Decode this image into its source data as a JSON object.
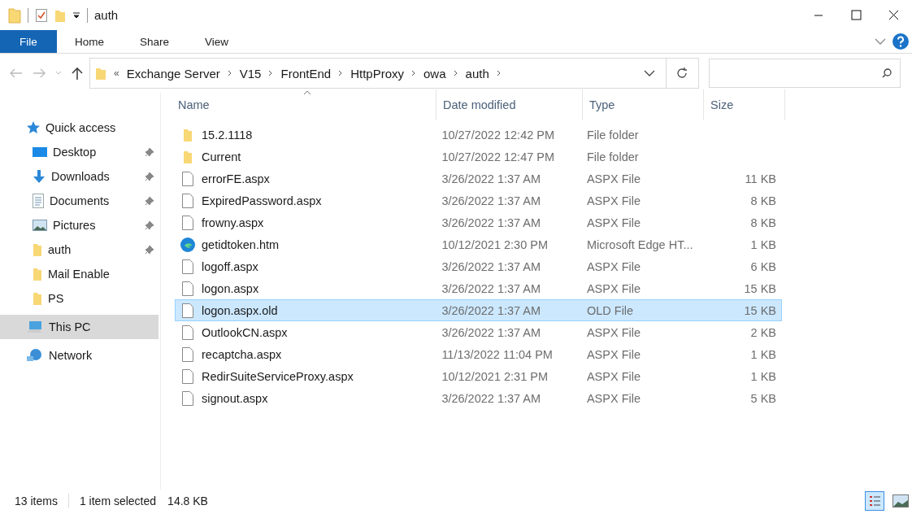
{
  "window": {
    "title": "auth"
  },
  "ribbon": {
    "tabs": [
      {
        "label": "File",
        "selected": true
      },
      {
        "label": "Home",
        "selected": false
      },
      {
        "label": "Share",
        "selected": false
      },
      {
        "label": "View",
        "selected": false
      }
    ]
  },
  "address": {
    "overflow": "«",
    "path": [
      "Exchange Server",
      "V15",
      "FrontEnd",
      "HttpProxy",
      "owa",
      "auth"
    ]
  },
  "columns": [
    "Name",
    "Date modified",
    "Type",
    "Size"
  ],
  "sidebar": {
    "items": [
      {
        "label": "Quick access",
        "kind": "star",
        "pinned": false,
        "selected": false
      },
      {
        "label": "Desktop",
        "kind": "desktop",
        "pinned": true,
        "selected": false
      },
      {
        "label": "Downloads",
        "kind": "download",
        "pinned": true,
        "selected": false
      },
      {
        "label": "Documents",
        "kind": "documents",
        "pinned": true,
        "selected": false
      },
      {
        "label": "Pictures",
        "kind": "pictures",
        "pinned": true,
        "selected": false
      },
      {
        "label": "auth",
        "kind": "folder",
        "pinned": true,
        "selected": false
      },
      {
        "label": "Mail Enable",
        "kind": "folder",
        "pinned": false,
        "selected": false
      },
      {
        "label": "PS",
        "kind": "folder",
        "pinned": false,
        "selected": false
      },
      {
        "label": "This PC",
        "kind": "pc",
        "pinned": false,
        "selected": true
      },
      {
        "label": "Network",
        "kind": "network",
        "pinned": false,
        "selected": false
      }
    ]
  },
  "files": [
    {
      "name": "15.2.1118",
      "date": "10/27/2022 12:42 PM",
      "type": "File folder",
      "kind": "folder",
      "selected": false
    },
    {
      "name": "Current",
      "date": "10/27/2022 12:47 PM",
      "type": "File folder",
      "kind": "folder",
      "selected": false
    },
    {
      "name": "errorFE.aspx",
      "date": "3/26/2022 1:37 AM",
      "type": "ASPX File",
      "size": "11 KB",
      "kind": "file",
      "selected": false
    },
    {
      "name": "ExpiredPassword.aspx",
      "date": "3/26/2022 1:37 AM",
      "type": "ASPX File",
      "size": "8 KB",
      "kind": "file",
      "selected": false
    },
    {
      "name": "frowny.aspx",
      "date": "3/26/2022 1:37 AM",
      "type": "ASPX File",
      "size": "8 KB",
      "kind": "file",
      "selected": false
    },
    {
      "name": "getidtoken.htm",
      "date": "10/12/2021 2:30 PM",
      "type": "Microsoft Edge HT...",
      "size": "1 KB",
      "kind": "edge",
      "selected": false
    },
    {
      "name": "logoff.aspx",
      "date": "3/26/2022 1:37 AM",
      "type": "ASPX File",
      "size": "6 KB",
      "kind": "file",
      "selected": false
    },
    {
      "name": "logon.aspx",
      "date": "3/26/2022 1:37 AM",
      "type": "ASPX File",
      "size": "15 KB",
      "kind": "file",
      "selected": false
    },
    {
      "name": "logon.aspx.old",
      "date": "3/26/2022 1:37 AM",
      "type": "OLD File",
      "size": "15 KB",
      "kind": "file",
      "selected": true
    },
    {
      "name": "OutlookCN.aspx",
      "date": "3/26/2022 1:37 AM",
      "type": "ASPX File",
      "size": "2 KB",
      "kind": "file",
      "selected": false
    },
    {
      "name": "recaptcha.aspx",
      "date": "11/13/2022 11:04 PM",
      "type": "ASPX File",
      "size": "1 KB",
      "kind": "file",
      "selected": false
    },
    {
      "name": "RedirSuiteServiceProxy.aspx",
      "date": "10/12/2021 2:31 PM",
      "type": "ASPX File",
      "size": "1 KB",
      "kind": "file",
      "selected": false
    },
    {
      "name": "signout.aspx",
      "date": "3/26/2022 1:37 AM",
      "type": "ASPX File",
      "size": "5 KB",
      "kind": "file",
      "selected": false
    }
  ],
  "status_bar": {
    "count": "13 items",
    "selection": "1 item selected",
    "size": "14.8 KB"
  }
}
